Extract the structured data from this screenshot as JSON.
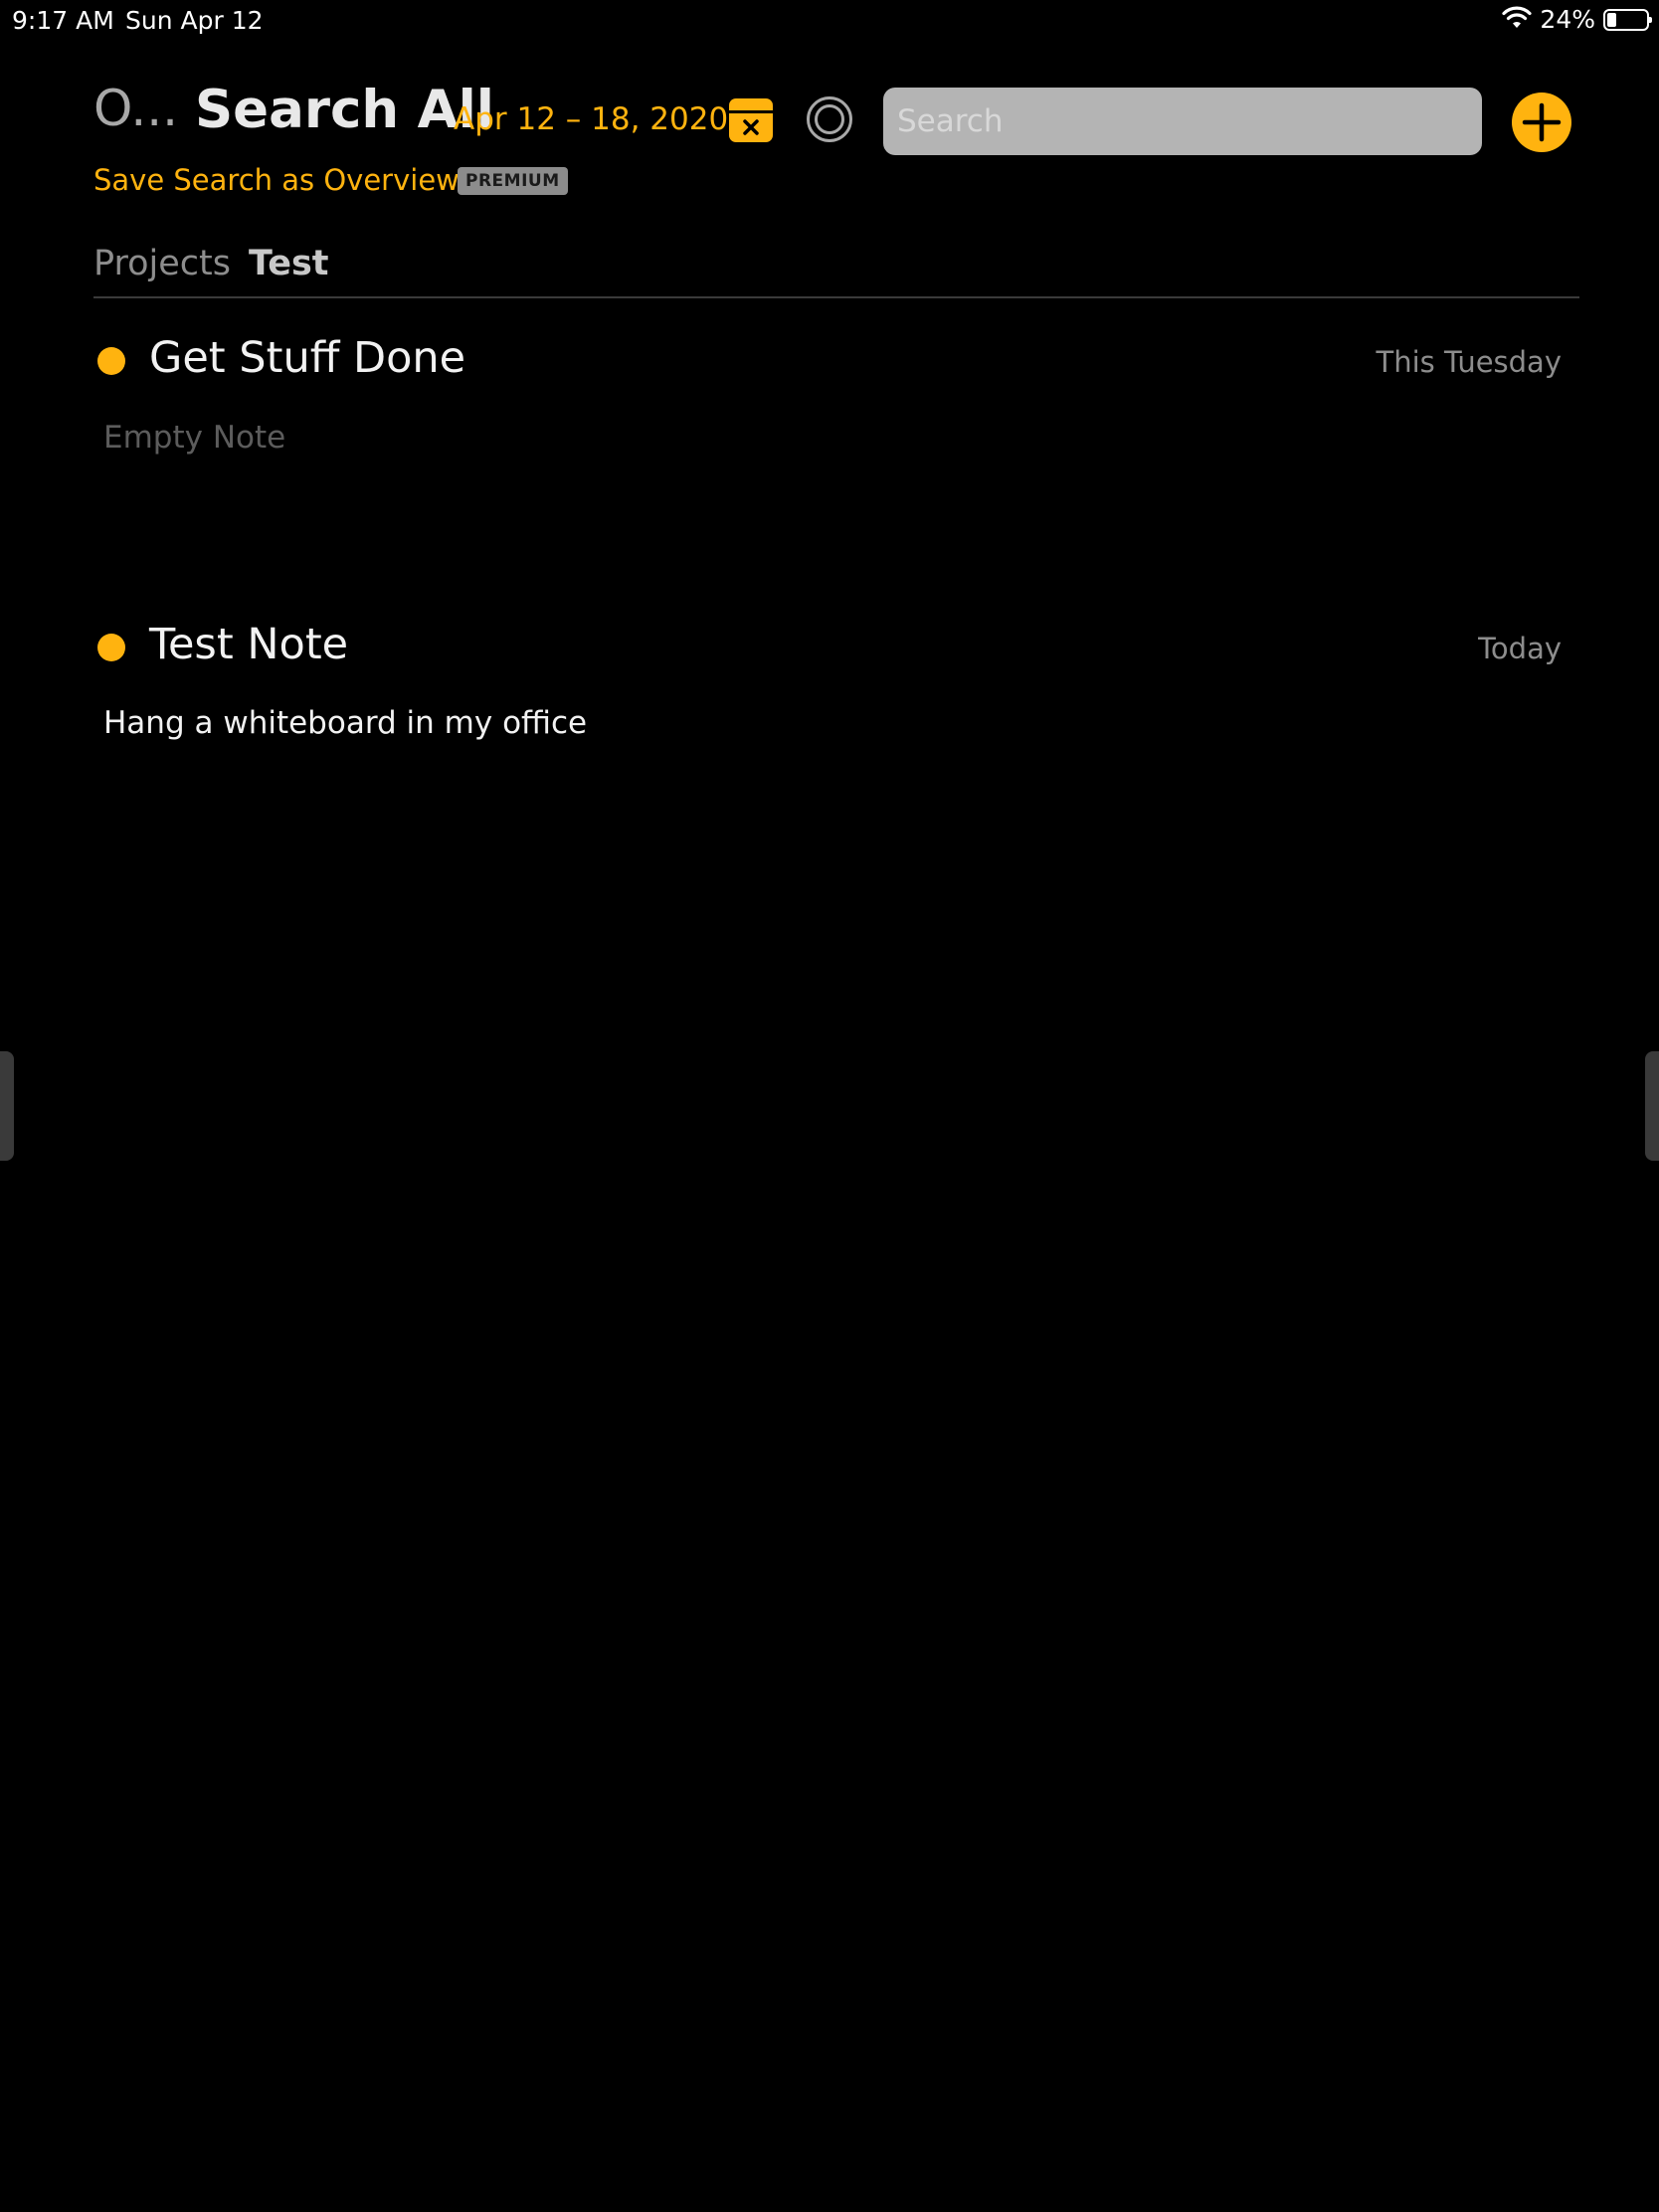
{
  "status_bar": {
    "time": "9:17 AM",
    "date": "Sun Apr 12",
    "battery_percent": "24%",
    "battery_level": 0.24
  },
  "header": {
    "back_title": "O...",
    "title": "Search All",
    "date_range": "Apr 12 – 18, 2020",
    "calendar_icon": "calendar-clear-icon",
    "circle_icon": "target-circle-icon",
    "add_icon": "plus-circle-icon"
  },
  "search": {
    "placeholder": "Search",
    "value": ""
  },
  "save_search": {
    "label": "Save Search as Overview",
    "badge": "PREMIUM"
  },
  "breadcrumb": {
    "parent": "Projects",
    "current": "Test"
  },
  "notes": [
    {
      "title": "Get Stuff Done",
      "date": "This Tuesday",
      "body": "Empty Note"
    },
    {
      "title": "Test Note",
      "date": "Today",
      "body": "Hang a whiteboard in my office"
    }
  ],
  "colors": {
    "accent": "#ffb30f",
    "background": "#000000",
    "search_bg": "#b4b4b4",
    "muted_text": "#8d8d8d"
  }
}
